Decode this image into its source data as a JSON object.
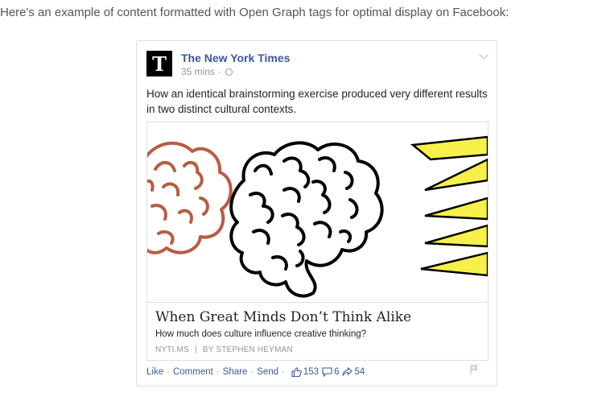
{
  "intro_text": "Here's an example of content formatted with Open Graph tags for optimal display on Facebook:",
  "post": {
    "page_name": "The New York Times",
    "logo_letter": "T",
    "time": "35 mins",
    "time_separator": "·",
    "message": "How an identical brainstorming exercise produced very different results in two distinct cultural contexts.",
    "link": {
      "title": "When Great Minds Don’t Think Alike",
      "description": "How much does culture influence creative thinking?",
      "domain": "NYTI.MS",
      "separator": "|",
      "author": "BY STEPHEN HEYMAN",
      "image": {
        "left_brain_color": "#b85c43",
        "center_brain_color": "#000000",
        "bolt_color": "#f7f04a"
      }
    },
    "actions": {
      "like": "Like",
      "comment": "Comment",
      "share": "Share",
      "send": "Send",
      "separator": "·",
      "likes_count": "153",
      "comments_count": "6",
      "shares_count": "54"
    }
  }
}
